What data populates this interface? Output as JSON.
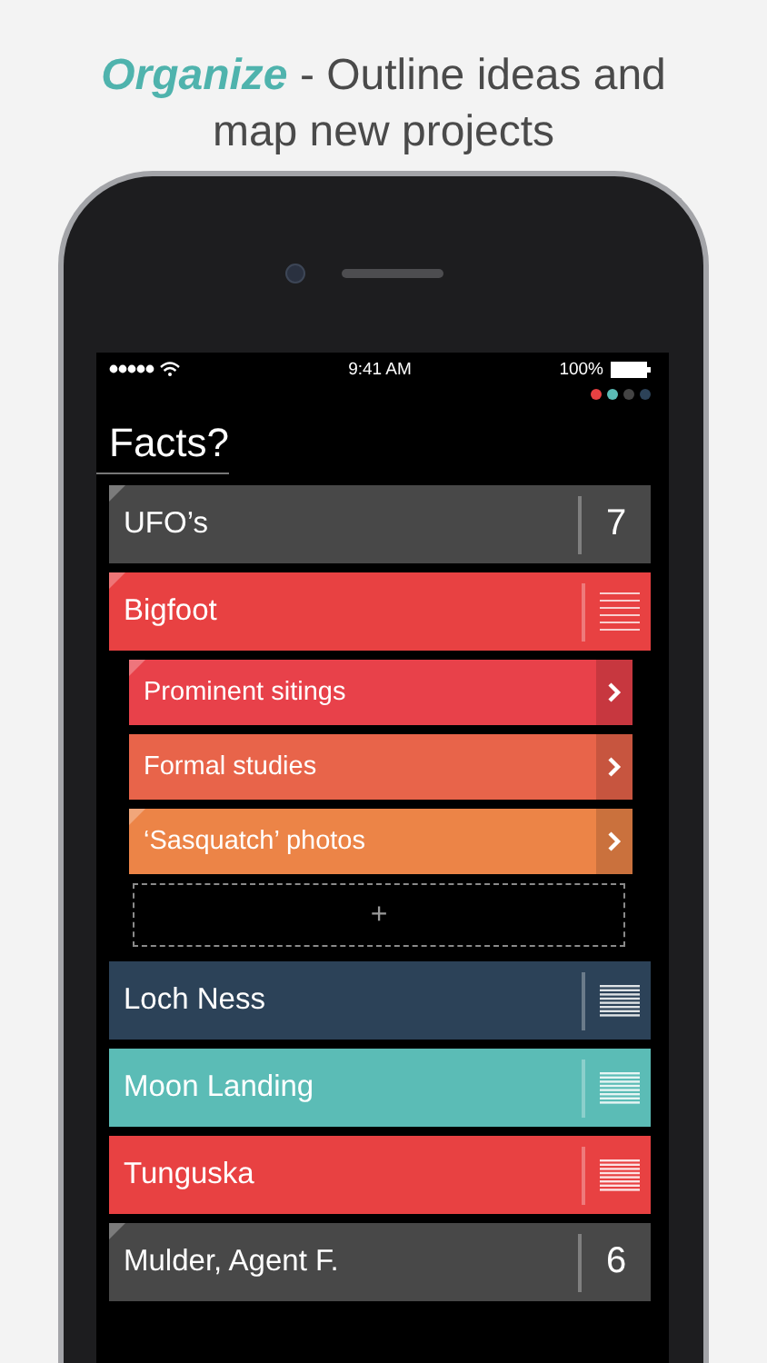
{
  "headline": "*Organize* - Outline ideas and map new projects",
  "status_bar": {
    "time": "9:41 AM",
    "battery": "100%"
  },
  "color_dots": [
    {
      "color": "#e84142"
    },
    {
      "color": "#5bbcb6"
    },
    {
      "color": "#444444"
    },
    {
      "color": "#2c4258"
    }
  ],
  "title": "Facts?",
  "items": [
    {
      "label": "UFO’s",
      "color": "#484848",
      "dog_ear": true,
      "count": "7"
    },
    {
      "label": "Bigfoot",
      "color": "#e84142",
      "dog_ear": true,
      "expanded": true,
      "children": [
        {
          "label": "Prominent sitings",
          "color": "#e8414a",
          "dog_ear": true
        },
        {
          "label": "Formal studies",
          "color": "#e8644a",
          "dog_ear": false
        },
        {
          "label": "‘Sasquatch’ photos",
          "color": "#ec8447",
          "dog_ear": true
        }
      ],
      "add_button": "+"
    },
    {
      "label": "Loch Ness",
      "color": "#2c4258",
      "dog_ear": false,
      "expanded": false
    },
    {
      "label": "Moon Landing",
      "color": "#5bbcb6",
      "dog_ear": false,
      "expanded": false
    },
    {
      "label": "Tunguska",
      "color": "#e84142",
      "dog_ear": false,
      "expanded": false
    },
    {
      "label": "Mulder, Agent F.",
      "color": "#484848",
      "dog_ear": true,
      "count": "6"
    }
  ]
}
